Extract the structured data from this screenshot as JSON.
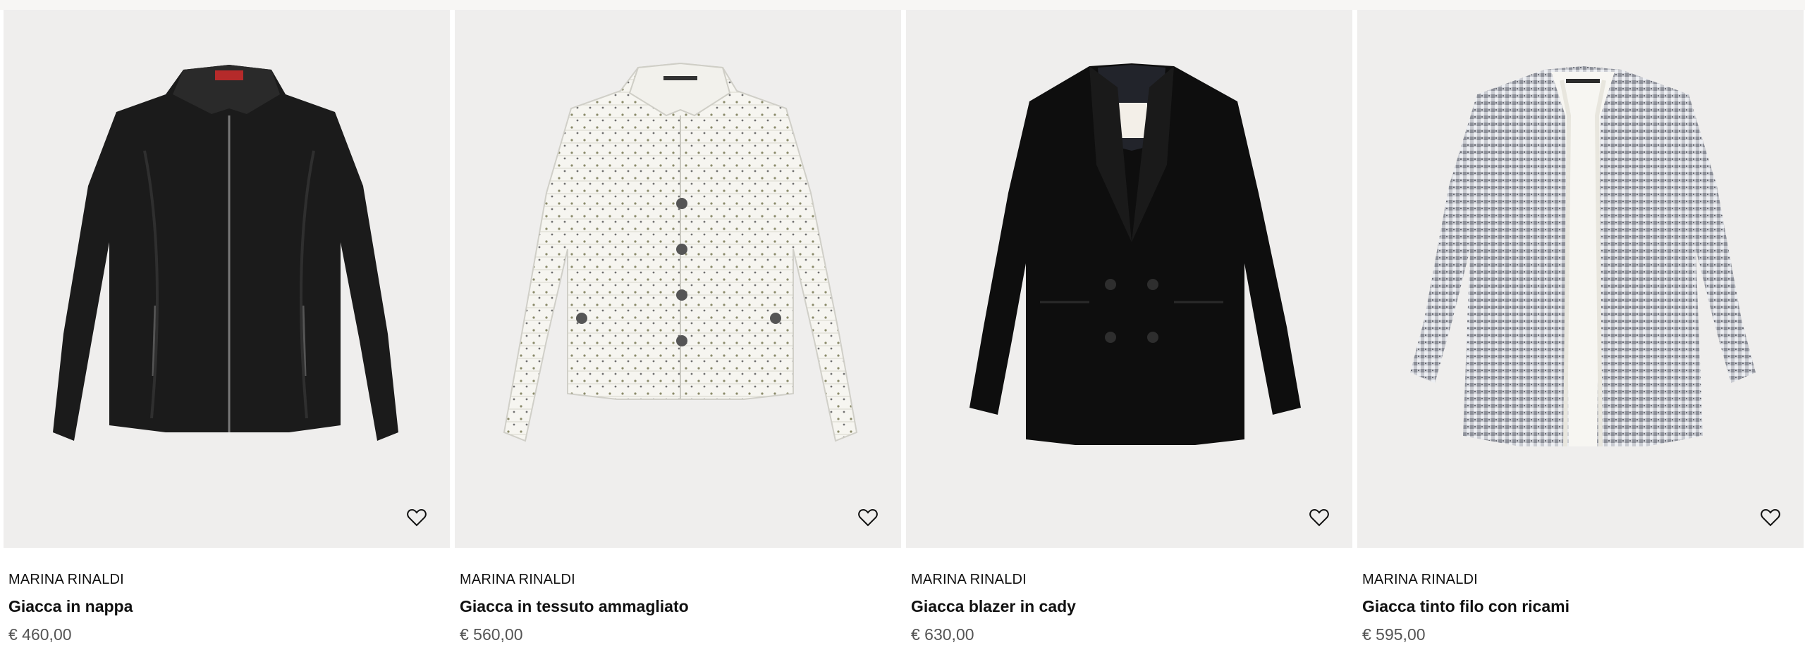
{
  "products": [
    {
      "brand": "MARINA RINALDI",
      "name": "Giacca in nappa",
      "price": "€ 460,00",
      "image": "black-leather-jacket",
      "fav_icon": "heart-outline-icon"
    },
    {
      "brand": "MARINA RINALDI",
      "name": "Giacca in tessuto ammagliato",
      "price": "€ 560,00",
      "image": "white-boucle-jacket",
      "fav_icon": "heart-outline-icon"
    },
    {
      "brand": "MARINA RINALDI",
      "name": "Giacca blazer in cady",
      "price": "€ 630,00",
      "image": "black-double-breasted-blazer",
      "fav_icon": "heart-outline-icon"
    },
    {
      "brand": "MARINA RINALDI",
      "name": "Giacca tinto filo con ricami",
      "price": "€ 595,00",
      "image": "grey-tweed-jacket",
      "fav_icon": "heart-outline-icon"
    }
  ],
  "colors": {
    "image_bg": "#efeeed",
    "text": "#111111",
    "price": "#555555"
  }
}
